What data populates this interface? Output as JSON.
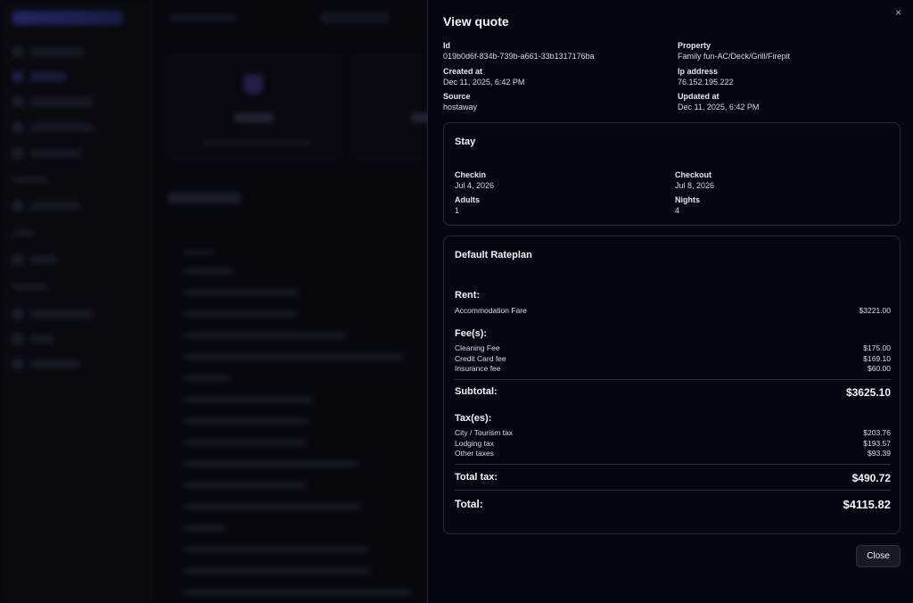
{
  "drawer": {
    "title": "View quote",
    "close_icon": "×",
    "meta": {
      "id_label": "Id",
      "id_value": "019b0d6f-834b-739b-a661-33b1317176ba",
      "property_label": "Property",
      "property_value": "Family fun-AC/Deck/Grill/Firepit",
      "created_label": "Created at",
      "created_value": "Dec 11, 2025, 6:42 PM",
      "ip_label": "Ip address",
      "ip_value": "76.152.195.222",
      "source_label": "Source",
      "source_value": "hostaway",
      "updated_label": "Updated at",
      "updated_value": "Dec 11, 2025, 6:42 PM"
    },
    "stay": {
      "title": "Stay",
      "checkin_label": "Checkin",
      "checkin_value": "Jul 4, 2026",
      "checkout_label": "Checkout",
      "checkout_value": "Jul 8, 2026",
      "adults_label": "Adults",
      "adults_value": "1",
      "nights_label": "Nights",
      "nights_value": "4"
    },
    "rateplan": {
      "title": "Default Rateplan",
      "rent_heading": "Rent:",
      "rent_items": [
        {
          "label": "Accommodation Fare",
          "amount": "$3221.00"
        }
      ],
      "fees_heading": "Fee(s):",
      "fee_items": [
        {
          "label": "Cleaning Fee",
          "amount": "$175.00"
        },
        {
          "label": "Credit Card fee",
          "amount": "$169.10"
        },
        {
          "label": "Insurance fee",
          "amount": "$60.00"
        }
      ],
      "subtotal_label": "Subtotal:",
      "subtotal_value": "$3625.10",
      "taxes_heading": "Tax(es):",
      "tax_items": [
        {
          "label": "City / Tourism tax",
          "amount": "$203.76"
        },
        {
          "label": "Lodging tax",
          "amount": "$193.57"
        },
        {
          "label": "Other taxes",
          "amount": "$93.39"
        }
      ],
      "total_tax_label": "Total tax:",
      "total_tax_value": "$490.72",
      "total_label": "Total:",
      "total_value": "$4115.82"
    },
    "close_button": "Close"
  }
}
